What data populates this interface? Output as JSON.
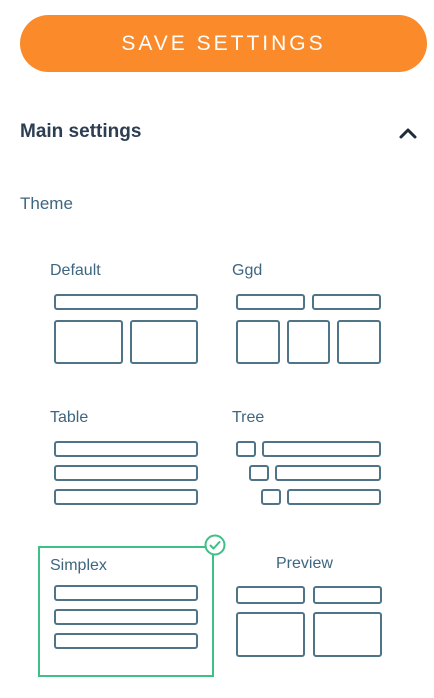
{
  "toolbar": {
    "save_label": "SAVE SETTINGS"
  },
  "section": {
    "title": "Main settings",
    "collapse_icon": "chevron-up-icon"
  },
  "theme": {
    "label": "Theme",
    "options": [
      {
        "name": "Default",
        "layout": "default"
      },
      {
        "name": "Ggd",
        "layout": "ggd"
      },
      {
        "name": "Table",
        "layout": "table"
      },
      {
        "name": "Tree",
        "layout": "tree"
      },
      {
        "name": "Simplex",
        "layout": "table",
        "selected": true
      },
      {
        "name": "Preview",
        "layout": "default"
      }
    ],
    "selected_icon": "check-circle-icon"
  },
  "colors": {
    "accent": "#fb8a2a",
    "selected_border": "#3dbf86",
    "thumb_stroke": "#4f7487",
    "heading": "#2d3e52",
    "label": "#3e6680"
  }
}
